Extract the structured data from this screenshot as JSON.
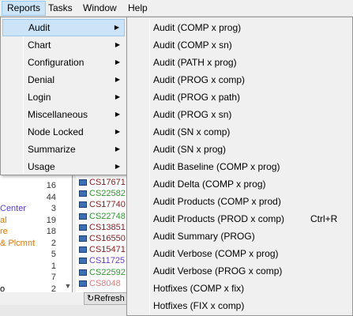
{
  "menubar": {
    "items": [
      {
        "label": "Reports"
      },
      {
        "label": "Tasks"
      },
      {
        "label": "Window"
      },
      {
        "label": "Help"
      }
    ]
  },
  "reports_menu": {
    "items": [
      {
        "label": "Audit"
      },
      {
        "label": "Chart"
      },
      {
        "label": "Configuration"
      },
      {
        "label": "Denial"
      },
      {
        "label": "Login"
      },
      {
        "label": "Miscellaneous"
      },
      {
        "label": "Node Locked"
      },
      {
        "label": "Summarize"
      },
      {
        "label": "Usage"
      }
    ],
    "arrow_glyph": "▶"
  },
  "audit_submenu": {
    "items": [
      {
        "label": "Audit (COMP x prog)",
        "shortcut": ""
      },
      {
        "label": "Audit (COMP x sn)",
        "shortcut": ""
      },
      {
        "label": "Audit (PATH x prog)",
        "shortcut": ""
      },
      {
        "label": "Audit (PROG x comp)",
        "shortcut": ""
      },
      {
        "label": "Audit (PROG x path)",
        "shortcut": ""
      },
      {
        "label": "Audit (PROG x sn)",
        "shortcut": ""
      },
      {
        "label": "Audit (SN x comp)",
        "shortcut": ""
      },
      {
        "label": "Audit (SN x prog)",
        "shortcut": ""
      },
      {
        "label": "Audit Baseline (COMP x prog)",
        "shortcut": ""
      },
      {
        "label": "Audit Delta (COMP x prog)",
        "shortcut": ""
      },
      {
        "label": "Audit Products (COMP x prod)",
        "shortcut": ""
      },
      {
        "label": "Audit Products (PROD x comp)",
        "shortcut": "Ctrl+R"
      },
      {
        "label": "Audit Summary (PROG)",
        "shortcut": ""
      },
      {
        "label": "Audit Verbose (COMP x prog)",
        "shortcut": ""
      },
      {
        "label": "Audit Verbose (PROG x comp)",
        "shortcut": ""
      },
      {
        "label": "Hotfixes (COMP x fix)",
        "shortcut": ""
      },
      {
        "label": "Hotfixes (FIX x comp)",
        "shortcut": ""
      }
    ]
  },
  "background": {
    "left_rows": [
      {
        "name": "",
        "count": "16",
        "color": "#000000"
      },
      {
        "name": "",
        "count": "44",
        "color": "#000000"
      },
      {
        "name": "Center",
        "count": "3",
        "color": "#5b3fd1"
      },
      {
        "name": "al",
        "count": "19",
        "color": "#e07b00"
      },
      {
        "name": "re",
        "count": "18",
        "color": "#e07b00"
      },
      {
        "name": "& Plcmnt",
        "count": "2",
        "color": "#e07b00"
      },
      {
        "name": "",
        "count": "5",
        "color": "#000000"
      },
      {
        "name": "",
        "count": "1",
        "color": "#000000"
      },
      {
        "name": "",
        "count": "7",
        "color": "#000000"
      },
      {
        "name": "o",
        "count": "2",
        "color": "#000000"
      }
    ],
    "right_items": [
      {
        "text": "CS17671",
        "color": "#8b1a1a"
      },
      {
        "text": "CS22582",
        "color": "#2e9a2e"
      },
      {
        "text": "CS17740",
        "color": "#8b1a1a"
      },
      {
        "text": "CS22748",
        "color": "#2e9a2e"
      },
      {
        "text": "CS13851",
        "color": "#8b1a1a"
      },
      {
        "text": "CS16550",
        "color": "#8b1a1a"
      },
      {
        "text": "CS15471",
        "color": "#8b1a1a"
      },
      {
        "text": "CS11725",
        "color": "#6a3fc8"
      },
      {
        "text": "CS22592",
        "color": "#2e9a2e"
      },
      {
        "text": "CS8048",
        "color": "#e07b7b"
      }
    ],
    "refresh_label": "Refresh",
    "scroll_glyph": "▼",
    "refresh_glyph": "↻"
  },
  "colors": {
    "highlight": "#cce4f7",
    "highlight_border": "#99c9ef",
    "menu_bg": "#f0f0f0"
  }
}
